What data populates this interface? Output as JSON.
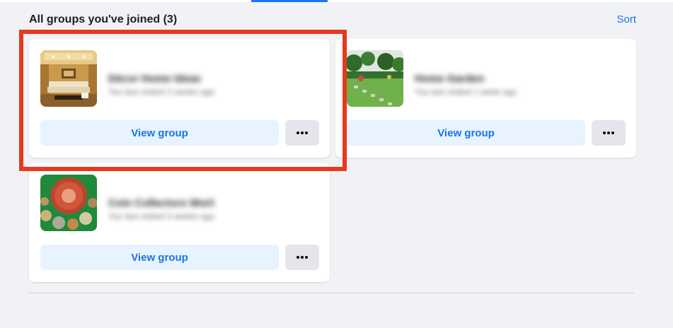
{
  "header": {
    "title": "All groups you've joined (3)",
    "sort_label": "Sort"
  },
  "groups": [
    {
      "name": "Décor Home Ideas",
      "meta": "You last visited 2 weeks ago",
      "view_label": "View group",
      "more_label": "···",
      "thumbnail": "living-room-photo"
    },
    {
      "name": "Home Garden",
      "meta": "You last visited 1 week ago",
      "view_label": "View group",
      "more_label": "···",
      "thumbnail": "garden-photo"
    },
    {
      "name": "Coin Collectors Worldwide",
      "meta": "You last visited 3 weeks ago",
      "view_label": "View group",
      "more_label": "···",
      "thumbnail": "coins-photo"
    }
  ],
  "colors": {
    "accent": "#1b74e4",
    "highlight": "#e8381e",
    "background": "#f0f2f5"
  }
}
